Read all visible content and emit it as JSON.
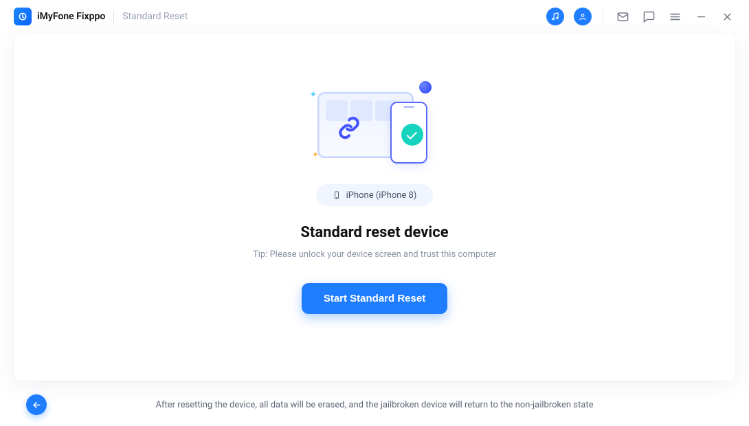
{
  "titlebar": {
    "app_name": "iMyFone Fixppo",
    "subtitle": "Standard Reset"
  },
  "device": {
    "label": "iPhone (iPhone 8)"
  },
  "main": {
    "headline": "Standard reset device",
    "tip": "Tip: Please unlock your device screen and trust this computer",
    "cta_label": "Start Standard Reset"
  },
  "footer": {
    "note": "After resetting the device, all data will be erased, and the jailbroken device will return to the non-jailbroken state"
  }
}
